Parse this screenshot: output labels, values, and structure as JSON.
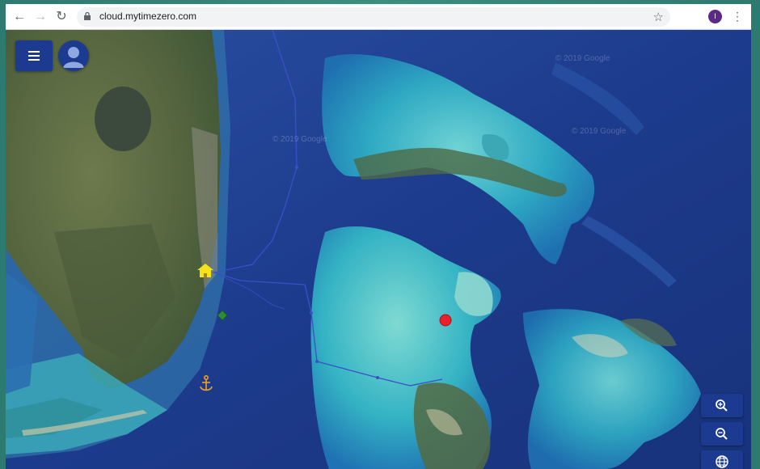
{
  "browser": {
    "url": "cloud.mytimezero.com",
    "profile_initial": "I"
  },
  "icons": {
    "back": "arrow-left-icon",
    "forward": "arrow-right-icon",
    "reload": "reload-icon",
    "lock": "lock-icon",
    "bookmark": "star-icon",
    "menu": "hamburger-menu-icon",
    "account": "user-avatar-icon",
    "home": "home-marker-icon",
    "anchor": "anchor-icon",
    "zoom_in": "zoom-in-icon",
    "zoom_out": "zoom-out-icon",
    "globe": "globe-icon"
  },
  "map": {
    "watermark_text": "© 2019 Google",
    "ui_color": "#1c3a8f",
    "route_color": "#3a4fc8",
    "position_color": "#e8222a",
    "home_marker_color": "#f5e21b",
    "anchor_color": "#f0a020",
    "waypoint_color": "#2e8b3a"
  }
}
